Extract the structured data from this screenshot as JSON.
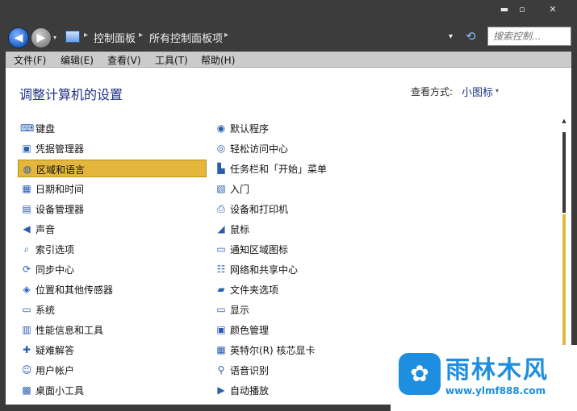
{
  "window": {
    "minimize": "▬",
    "maximize": "▫",
    "close": "✕"
  },
  "nav": {
    "back": "◀",
    "forward": "▶",
    "history_dropdown": "▾",
    "address_dropdown": "▾",
    "refresh": "⟲"
  },
  "breadcrumb": [
    {
      "label": "控制面板"
    },
    {
      "label": "所有控制面板项"
    }
  ],
  "breadcrumb_sep": "▸",
  "search": {
    "placeholder": "搜索控制..."
  },
  "menu": [
    "文件(F)",
    "编辑(E)",
    "查看(V)",
    "工具(T)",
    "帮助(H)"
  ],
  "page": {
    "title": "调整计算机的设置",
    "view_label": "查看方式:",
    "view_value": "小图标",
    "view_arrow": "▾"
  },
  "left_items": [
    {
      "label": "键盘",
      "icon": "keyboard-icon",
      "glyph": "⌨"
    },
    {
      "label": "凭据管理器",
      "icon": "credential-icon",
      "glyph": "▣"
    },
    {
      "label": "区域和语言",
      "icon": "globe-icon",
      "glyph": "◍",
      "selected": true
    },
    {
      "label": "日期和时间",
      "icon": "calendar-icon",
      "glyph": "▦"
    },
    {
      "label": "设备管理器",
      "icon": "device-manager-icon",
      "glyph": "▤"
    },
    {
      "label": "声音",
      "icon": "speaker-icon",
      "glyph": "◀"
    },
    {
      "label": "索引选项",
      "icon": "index-icon",
      "glyph": "⌕"
    },
    {
      "label": "同步中心",
      "icon": "sync-icon",
      "glyph": "⟳"
    },
    {
      "label": "位置和其他传感器",
      "icon": "sensor-icon",
      "glyph": "◈"
    },
    {
      "label": "系统",
      "icon": "system-icon",
      "glyph": "▭"
    },
    {
      "label": "性能信息和工具",
      "icon": "performance-icon",
      "glyph": "▥"
    },
    {
      "label": "疑难解答",
      "icon": "troubleshoot-icon",
      "glyph": "✚"
    },
    {
      "label": "用户帐户",
      "icon": "user-icon",
      "glyph": "☺"
    },
    {
      "label": "桌面小工具",
      "icon": "gadget-icon",
      "glyph": "▩"
    }
  ],
  "right_items": [
    {
      "label": "默认程序",
      "icon": "default-programs-icon",
      "glyph": "◉"
    },
    {
      "label": "轻松访问中心",
      "icon": "accessibility-icon",
      "glyph": "◎"
    },
    {
      "label": "任务栏和「开始」菜单",
      "icon": "taskbar-icon",
      "glyph": "▙"
    },
    {
      "label": "入门",
      "icon": "getting-started-icon",
      "glyph": "▧"
    },
    {
      "label": "设备和打印机",
      "icon": "printer-icon",
      "glyph": "⎙"
    },
    {
      "label": "鼠标",
      "icon": "mouse-icon",
      "glyph": "◢"
    },
    {
      "label": "通知区域图标",
      "icon": "notification-icon",
      "glyph": "▭"
    },
    {
      "label": "网络和共享中心",
      "icon": "network-icon",
      "glyph": "☷"
    },
    {
      "label": "文件夹选项",
      "icon": "folder-icon",
      "glyph": "▰"
    },
    {
      "label": "显示",
      "icon": "display-icon",
      "glyph": "▭"
    },
    {
      "label": "颜色管理",
      "icon": "color-management-icon",
      "glyph": "▣"
    },
    {
      "label": "英特尔(R) 核芯显卡",
      "icon": "intel-graphics-icon",
      "glyph": "▦"
    },
    {
      "label": "语音识别",
      "icon": "microphone-icon",
      "glyph": "⚲"
    },
    {
      "label": "自动播放",
      "icon": "autoplay-icon",
      "glyph": "▶"
    }
  ],
  "scrollbar": {
    "up_arrow": "▲"
  },
  "watermark": {
    "logo_glyph": "✿",
    "title": "雨林木风",
    "url": "www.ylmf888.com"
  }
}
